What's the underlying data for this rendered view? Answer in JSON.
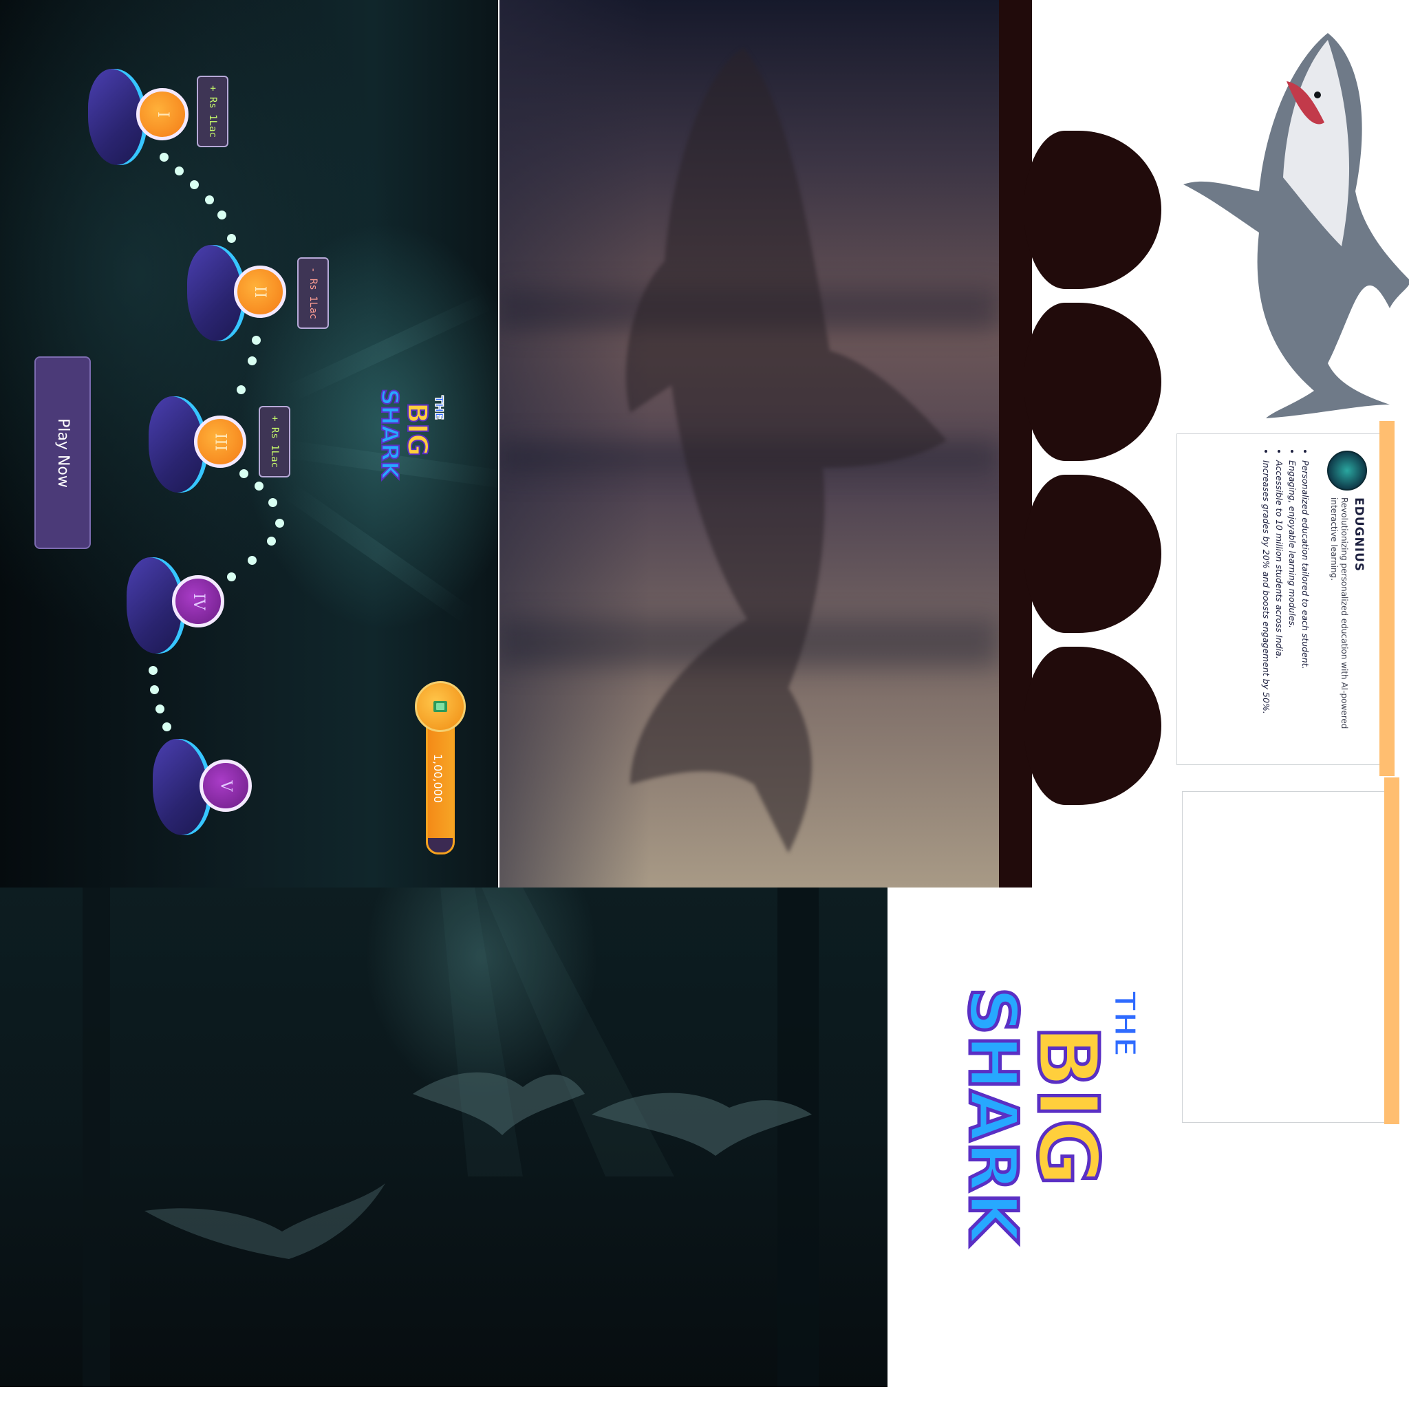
{
  "level_map": {
    "nodes": [
      {
        "numeral": "I",
        "state": "unlocked"
      },
      {
        "numeral": "II",
        "state": "unlocked"
      },
      {
        "numeral": "III",
        "state": "unlocked"
      },
      {
        "numeral": "IV",
        "state": "locked"
      },
      {
        "numeral": "V",
        "state": "locked"
      }
    ],
    "rewards": [
      {
        "label": "+ Rs 1Lac",
        "kind": "gain"
      },
      {
        "label": "- Rs 1Lac",
        "kind": "loss"
      },
      {
        "label": "+ Rs 1Lac",
        "kind": "gain"
      }
    ],
    "play_button": "Play Now",
    "balance": "1,00,000",
    "balance_fill_fraction": 0.9,
    "colors": {
      "rock": "#3a2f95",
      "rock_edge": "#37c6ff",
      "coin_orange": "#f58a1c",
      "coin_purple": "#7a2296",
      "trail": "#d9fff2",
      "button": "#4b3a78"
    }
  },
  "logo": {
    "line1": "THE",
    "line2": "BIG",
    "line3": "SHARK",
    "colors": {
      "the": "#2f6bff",
      "big": "#ffcf3c",
      "shark": "#27a8ff",
      "outline": "#5a2fc4"
    }
  },
  "info_card": {
    "company": "EDUGNIUS",
    "logo_text": "EDUGNIUS",
    "tagline": "Revolutionizing personalized education with AI-powered interactive learning.",
    "features": [
      "Personalized education tailored to each student.",
      "Engaging, enjoyable learning modules.",
      "Accessible to 10 million students across India.",
      "Increases grades by 20% and boosts engagement by 50%."
    ],
    "accent": "#ffbe70"
  }
}
